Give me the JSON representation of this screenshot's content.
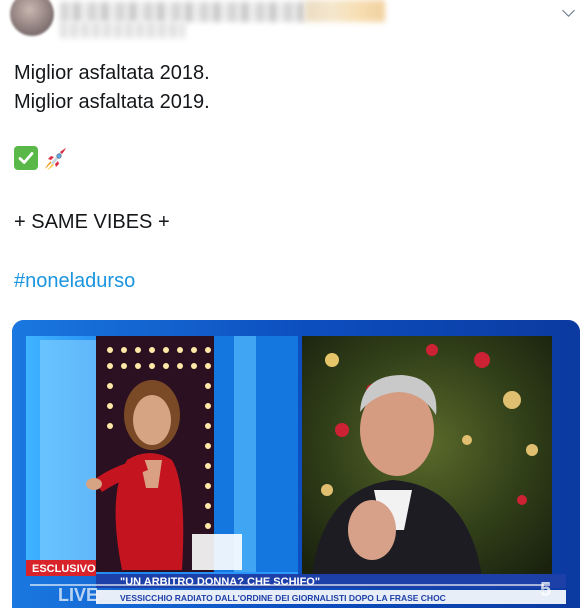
{
  "tweet": {
    "lines": [
      "Miglior asfaltata 2018.",
      "Miglior asfaltata 2019."
    ],
    "emojis": [
      "check-mark-icon",
      "rocket-icon"
    ],
    "vibes": "+ SAME VIBES +",
    "hashtag": "#noneladurso"
  },
  "video": {
    "badge": "ESCLUSIVO",
    "headline": "\"UN ARBITRO DONNA? CHE SCHIFO\"",
    "ticker": "VESSICCHIO RADIATO DALL'ORDINE DEI GIORNALISTI DOPO LA FRASE CHOC",
    "live_label": "LIVE",
    "channel": "5"
  },
  "colors": {
    "hashtag": "#1b95e0",
    "studio_blue": "#1552c4",
    "banner_blue": "#1d3fa8",
    "badge_red": "#d8232a"
  }
}
